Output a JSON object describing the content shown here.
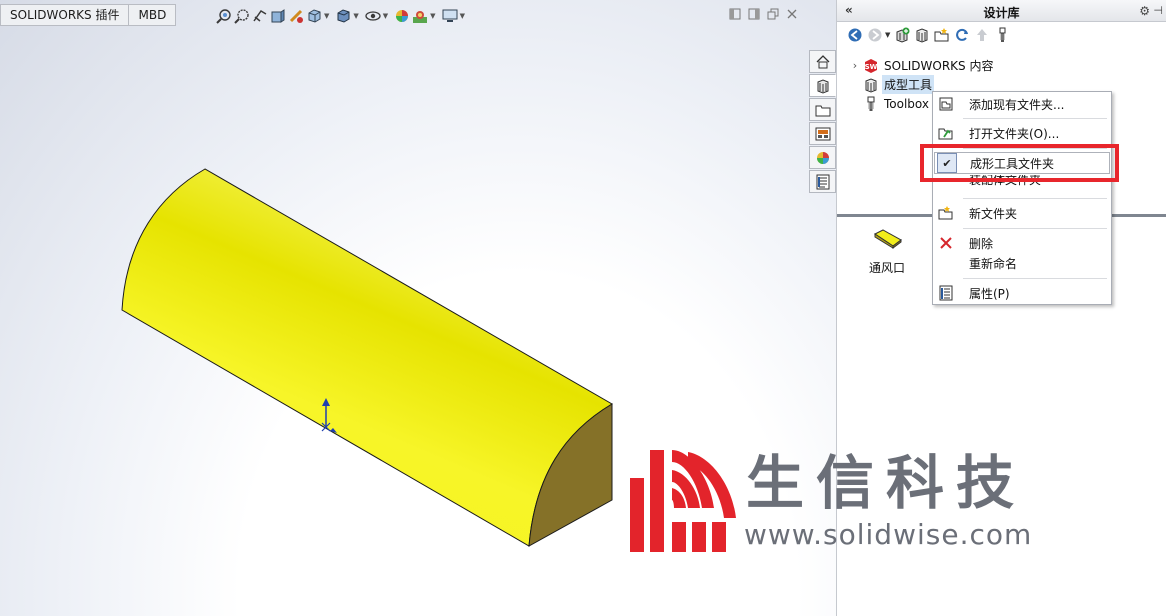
{
  "command_tabs": [
    "SOLIDWORKS 插件",
    "MBD"
  ],
  "viewport": {
    "headsup_icons": [
      "zoom-to-fit-icon",
      "zoom-area-icon",
      "previous-view-icon",
      "section-view-icon",
      "dynamic-annotation-icon",
      "view-orientation-icon",
      "display-style-icon",
      "hide-show-icon",
      "edit-appearance-icon",
      "apply-scene-icon",
      "view-settings-icon"
    ],
    "window_controls": [
      "tile-left-icon",
      "tile-right-icon",
      "restore-icon",
      "close-icon"
    ],
    "model_color": "#f2f213",
    "model_end_color": "#857128",
    "triad_color": "#1f3fb0"
  },
  "taskpane_tabs": [
    "home-tab-icon",
    "design-library-tab-icon",
    "file-explorer-tab-icon",
    "view-palette-tab-icon",
    "appearances-tab-icon",
    "custom-properties-tab-icon"
  ],
  "panel": {
    "collapse": "«",
    "title": "设计库",
    "options": "⚙",
    "pin": "⊣",
    "toolbar": [
      "back-icon",
      "forward-icon",
      "add-to-library-icon",
      "add-file-location-icon",
      "create-new-folder-icon",
      "refresh-icon",
      "up-icon",
      "toolbox-icon"
    ],
    "tree": [
      {
        "label": "SOLIDWORKS 内容",
        "has_arrow": true,
        "icon": "solidworks-content-icon",
        "selected": false
      },
      {
        "label": "成型工具",
        "has_arrow": false,
        "icon": "forming-tools-icon",
        "selected": true
      },
      {
        "label": "Toolbox",
        "has_arrow": false,
        "icon": "toolbox-icon",
        "selected": false
      }
    ],
    "files": [
      {
        "label": "通风口",
        "icon": "part-file-icon"
      }
    ]
  },
  "context_menu": {
    "items": [
      {
        "label": "添加现有文件夹...",
        "icon": "add-folder-icon"
      },
      {
        "label": "打开文件夹(O)...",
        "icon": "open-folder-icon"
      },
      {
        "label": "成形工具文件夹",
        "icon": "checkmark-icon",
        "checked": true
      },
      {
        "label": "装配体文件夹",
        "icon": ""
      },
      {
        "label": "新文件夹",
        "icon": "new-folder-icon"
      },
      {
        "label": "删除",
        "icon": "delete-icon"
      },
      {
        "label": "重新命名",
        "icon": ""
      },
      {
        "label": "属性(P)",
        "icon": "properties-icon"
      }
    ],
    "highlight_color": "#e8262c"
  },
  "watermark": {
    "text_cn": "生信科技",
    "url": "www.solidwise.com",
    "logo_color": "#e3242b"
  }
}
